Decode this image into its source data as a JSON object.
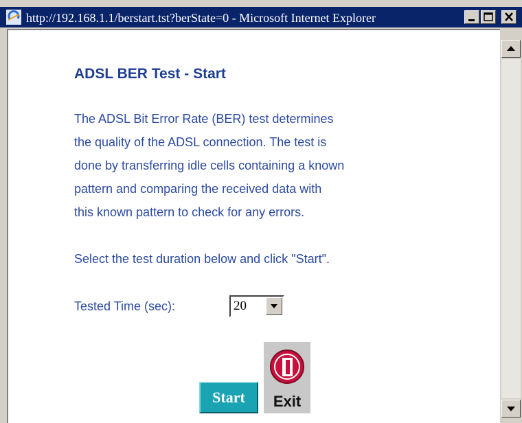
{
  "window": {
    "title": "http://192.168.1.1/berstart.tst?berState=0 - Microsoft Internet Explorer"
  },
  "page": {
    "heading": "ADSL BER Test - Start",
    "description_lines": [
      "The ADSL Bit Error Rate (BER) test determines",
      "the quality of the ADSL connection. The test is",
      "done by transferring idle cells containing a known",
      "pattern and comparing the received data with",
      "this known pattern to check for any errors."
    ],
    "instruction": "Select the test duration below and click \"Start\".",
    "tested_time_label": "Tested Time (sec):",
    "tested_time_value": "20",
    "start_label": "Start",
    "exit_label": "Exit"
  },
  "icons": {
    "ie": "ie-icon",
    "minimize": "minimize-icon",
    "maximize": "maximize-icon",
    "close": "close-icon",
    "exit": "exit-icon"
  },
  "colors": {
    "titlebar": "#0a246a",
    "text": "#2c4aa0",
    "heading": "#1f3f94",
    "start_button": "#1aa3b3",
    "exit_icon": "#c8103c"
  }
}
